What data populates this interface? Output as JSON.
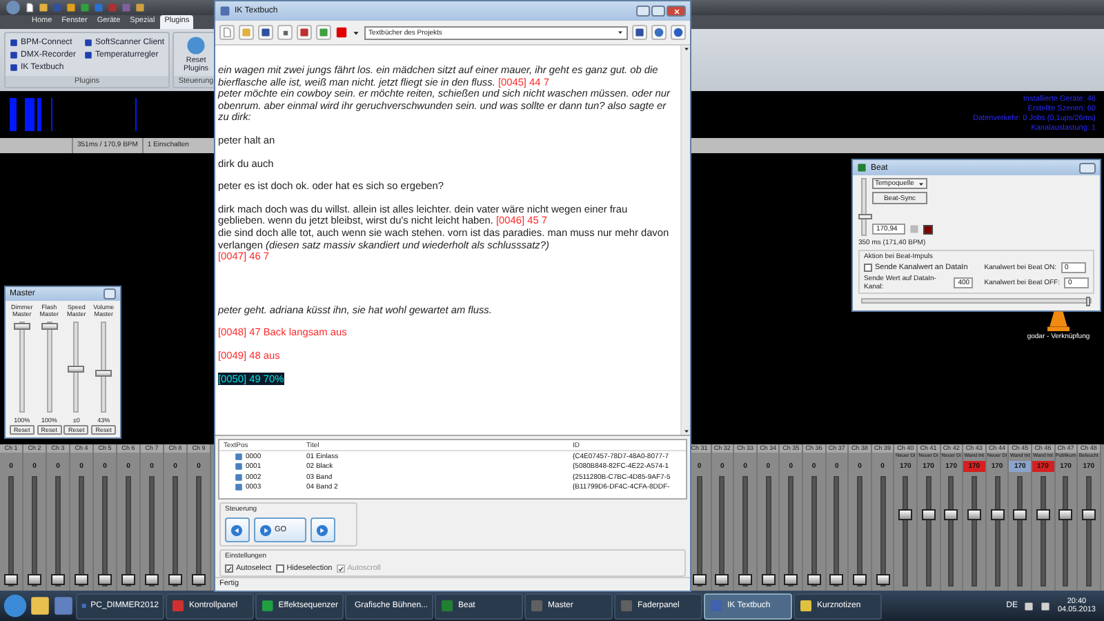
{
  "ribbon": {
    "tabs": [
      {
        "label": "Home",
        "selected": false
      },
      {
        "label": "Fenster",
        "selected": false
      },
      {
        "label": "Geräte",
        "selected": false
      },
      {
        "label": "Spezial",
        "selected": false
      },
      {
        "label": "Plugins",
        "selected": true
      }
    ],
    "groups": [
      {
        "label": "Plugins",
        "items": [
          {
            "label": "BPM-Connect",
            "kind": "small"
          },
          {
            "label": "DMX-Recorder",
            "kind": "small"
          },
          {
            "label": "IK Textbuch",
            "kind": "small"
          },
          {
            "label": "SoftScanner Client",
            "kind": "small"
          },
          {
            "label": "Temperaturregler",
            "kind": "small"
          }
        ]
      },
      {
        "label": "Steuerung",
        "items": [
          {
            "label": "Reset Plugins",
            "kind": "large"
          }
        ]
      }
    ]
  },
  "info": [
    "Installierte Geräte: 46",
    "Erstellte Szenen: 60",
    "Datenverkehr: 0 Jobs (0,1ups/26ms)",
    "Kanalauslastung: 1"
  ],
  "status_bar": [
    "351ms / 170,9 BPM",
    "1 Einschalten"
  ],
  "textbook": {
    "title": "IK Textbuch",
    "book_select": "Textbücher des Projekts",
    "paragraphs": [
      {
        "kind": "para",
        "segments": [
          {
            "kind": "italic",
            "text": "ein wagen mit zwei jungs fährt los. ein mädchen sitzt auf einer mauer, ihr geht es ganz gut. ob die bierflasche alle ist, weiß man nicht. jetzt fliegt sie in den fluss."
          },
          {
            "kind": "cue",
            "text": "[0045] 44 7"
          }
        ]
      },
      {
        "kind": "flow",
        "segments": [
          {
            "kind": "italic",
            "text": "peter möchte ein cowboy sein. er möchte reiten, schießen und sich nicht waschen müssen. oder nur obenrum. aber einmal wird ihr geruchverschwunden sein. und was sollte er dann tun? also sagte er zu dirk:"
          }
        ]
      },
      {
        "kind": "para",
        "segments": [
          {
            "kind": "plain",
            "text": "peter halt an"
          }
        ]
      },
      {
        "kind": "para",
        "segments": [
          {
            "kind": "plain",
            "text": "dirk du auch"
          }
        ]
      },
      {
        "kind": "para",
        "segments": [
          {
            "kind": "plain",
            "text": "peter es ist doch ok. oder hat es sich so ergeben?"
          }
        ]
      },
      {
        "kind": "para",
        "segments": [
          {
            "kind": "plain",
            "text": "dirk mach doch was du willst. allein ist alles leichter. dein vater wäre nicht wegen einer frau geblieben. wenn du jetzt bleibst, wirst du's nicht leicht haben."
          },
          {
            "kind": "cue",
            "text": "[0046] 45 7"
          }
        ]
      },
      {
        "kind": "flow",
        "segments": [
          {
            "kind": "plain",
            "text": "die sind doch alle tot, auch wenn sie wach stehen. vorn ist das paradies. man muss nur mehr davon verlangen"
          },
          {
            "kind": "italic",
            "text": "(diesen satz massiv skandiert und wiederholt als schlusssatz?)"
          }
        ]
      },
      {
        "kind": "flow",
        "segments": [
          {
            "kind": "cue",
            "text": "[0047] 46 7"
          }
        ]
      },
      {
        "kind": "section",
        "segments": [
          {
            "kind": "italic",
            "text": "peter geht. adriana küsst ihn, sie hat wohl gewartet am fluss."
          }
        ]
      },
      {
        "kind": "para",
        "segments": [
          {
            "kind": "cue",
            "text": "[0048] 47 Back langsam aus"
          }
        ]
      },
      {
        "kind": "para",
        "segments": [
          {
            "kind": "cue",
            "text": "[0049] 48 aus"
          }
        ]
      },
      {
        "kind": "para",
        "segments": [
          {
            "kind": "current",
            "text": "[0050] 49 70%"
          }
        ]
      }
    ],
    "list": {
      "columns": [
        "TextPos",
        "Titel",
        "ID"
      ],
      "rows": [
        {
          "cells": [
            "0000",
            "01 Einlass",
            "{C4E07457-78D7-48A0-8077-7"
          ]
        },
        {
          "cells": [
            "0001",
            "02 Black",
            "{5080B848-82FC-4E22-A574-1"
          ]
        },
        {
          "cells": [
            "0002",
            "03 Band",
            "{2511280B-C7BC-4D85-9AF7-5"
          ]
        },
        {
          "cells": [
            "0003",
            "04 Band 2",
            "{B11799D6-DF4C-4CFA-8DDF-"
          ]
        }
      ]
    },
    "control_group": "Steuerung",
    "go_label": "GO",
    "settings_group": "Einstellungen",
    "settings": [
      {
        "label": "Autoselect",
        "checked": true,
        "disabled": false
      },
      {
        "label": "Hideselection",
        "checked": false,
        "disabled": false
      },
      {
        "label": "Autoscroll",
        "checked": true,
        "disabled": true
      }
    ],
    "status": "Fertig"
  },
  "master": {
    "title": "Master",
    "faders": [
      {
        "label": "Dimmer Master",
        "level": 1,
        "reading": "100%",
        "reset": "Reset"
      },
      {
        "label": "Flash Master",
        "level": 1,
        "reading": "100%",
        "reset": "Reset"
      },
      {
        "label": "Speed Master",
        "level": 0.48,
        "reading": "±0",
        "reset": "Reset"
      },
      {
        "label": "Volume Master",
        "level": 0.43,
        "reading": "43%",
        "reset": "Reset"
      }
    ]
  },
  "beat": {
    "title": "Beat",
    "source": "Tempoquelle",
    "sync": "Beat-Sync",
    "tempo": "170,94",
    "tempo_slider": {
      "level": 0.3
    },
    "interval": "350 ms (171,40 BPM)",
    "group": "Aktion bei Beat-Impuls",
    "send_check": {
      "label": "Sende Kanalwert an DataIn",
      "checked": false
    },
    "send_channel_label": "Sende Wert auf DataIn-Kanal:",
    "send_channel": "400",
    "on_label": "Kanalwert bei Beat ON:",
    "on_value": "0",
    "off_label": "Kanalwert bei Beat OFF:",
    "off_value": "0",
    "bottom_slider": {
      "level": 1
    }
  },
  "desktop_icon": "godar - Verknüpfung",
  "channels_left": [
    {
      "label": "Ch 1",
      "value": "0",
      "level": 0
    },
    {
      "label": "Ch 2",
      "value": "0",
      "level": 0
    },
    {
      "label": "Ch 3",
      "value": "0",
      "level": 0
    },
    {
      "label": "Ch 4",
      "value": "0",
      "level": 0
    },
    {
      "label": "Ch 5",
      "value": "0",
      "level": 0
    },
    {
      "label": "Ch 6",
      "value": "0",
      "level": 0
    },
    {
      "label": "Ch 7",
      "value": "0",
      "level": 0
    },
    {
      "label": "Ch 8",
      "value": "0",
      "level": 0
    },
    {
      "label": "Ch 9",
      "value": "0",
      "level": 0
    }
  ],
  "channels_right": [
    {
      "label": "Ch 31",
      "value": "0",
      "level": 0
    },
    {
      "label": "Ch 32",
      "value": "0",
      "level": 0
    },
    {
      "label": "Ch 33",
      "value": "0",
      "level": 0
    },
    {
      "label": "Ch 34",
      "value": "0",
      "level": 0
    },
    {
      "label": "Ch 35",
      "value": "0",
      "level": 0
    },
    {
      "label": "Ch 36",
      "value": "0",
      "level": 0
    },
    {
      "label": "Ch 37",
      "value": "0",
      "level": 0
    },
    {
      "label": "Ch 38",
      "value": "0",
      "level": 0
    },
    {
      "label": "Ch 39",
      "value": "0",
      "level": 0
    },
    {
      "label": "Ch 40",
      "name": "Neuer Di",
      "value": "170",
      "level": 0.67
    },
    {
      "label": "Ch 41",
      "name": "Neuer Di",
      "value": "170",
      "level": 0.67
    },
    {
      "label": "Ch 42",
      "name": "Neuer Di",
      "value": "170",
      "level": 0.67
    },
    {
      "label": "Ch 43",
      "name": "Wand Int",
      "value": "170",
      "level": 0.67,
      "color": "#d42020"
    },
    {
      "label": "Ch 44",
      "name": "Neuer Di",
      "value": "170",
      "level": 0.67
    },
    {
      "label": "Ch 45",
      "name": "Wand Int",
      "value": "170",
      "level": 0.67,
      "color": "#8aa4cc"
    },
    {
      "label": "Ch 46",
      "name": "Wand Int",
      "value": "170",
      "level": 0.67,
      "color": "#d42020"
    },
    {
      "label": "Ch 47",
      "name": "Publikum",
      "value": "170",
      "level": 0.67
    },
    {
      "label": "Ch 48",
      "name": "Beleucht",
      "value": "170",
      "level": 0.67
    }
  ],
  "taskbar": {
    "items": [
      {
        "label": "PC_DIMMER2012",
        "selected": false
      },
      {
        "label": "Kontrollpanel",
        "selected": false
      },
      {
        "label": "Effektsequenzer",
        "selected": false
      },
      {
        "label": "Grafische Bühnen...",
        "selected": false
      },
      {
        "label": "Beat",
        "selected": false
      },
      {
        "label": "Master",
        "selected": false
      },
      {
        "label": "Faderpanel",
        "selected": false
      },
      {
        "label": "IK Textbuch",
        "selected": true
      },
      {
        "label": "Kurznotizen",
        "selected": false
      }
    ],
    "language": "DE",
    "time": "20:40",
    "date": "04.05.2013"
  }
}
